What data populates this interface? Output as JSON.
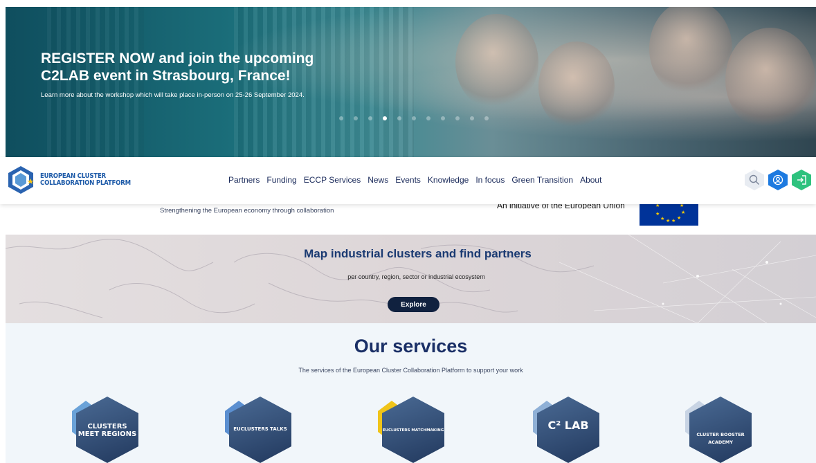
{
  "hero": {
    "title": "REGISTER NOW and join the upcoming C2LAB event in Strasbourg, France!",
    "subtitle": "Learn more about the workshop which will take place in-person on 25-26 September 2024.",
    "slide_count": 11,
    "active_slide": 4
  },
  "header": {
    "logo_line1": "EUROPEAN CLUSTER",
    "logo_line2": "COLLABORATION PLATFORM",
    "nav": [
      "Partners",
      "Funding",
      "ECCP Services",
      "News",
      "Events",
      "Knowledge",
      "In focus",
      "Green Transition",
      "About"
    ],
    "icons": [
      "search-icon",
      "user-icon",
      "login-icon"
    ]
  },
  "tagline": "Strengthening the European economy through collaboration",
  "eu_initiative": "An initiative of the European Union",
  "map_banner": {
    "title": "Map industrial clusters and find partners",
    "subtitle": "per country, region, sector or industrial ecosystem",
    "button": "Explore"
  },
  "services": {
    "title": "Our services",
    "subtitle": "The services of the European Cluster Collaboration Platform to support your work",
    "badges": [
      {
        "label": "CLUSTERS MEET REGIONS",
        "accent": "#6aa2d8"
      },
      {
        "label": "EUCLUSTERS TALKS",
        "accent": "#5b8fd0"
      },
      {
        "label": "EUCLUSTERS MATCHMAKING",
        "accent": "#f0c419"
      },
      {
        "label": "C² LAB",
        "accent": "#8fb0d6"
      },
      {
        "label": "CLUSTER BOOSTER ACADEMY",
        "accent": "#c8d4e4"
      }
    ]
  }
}
